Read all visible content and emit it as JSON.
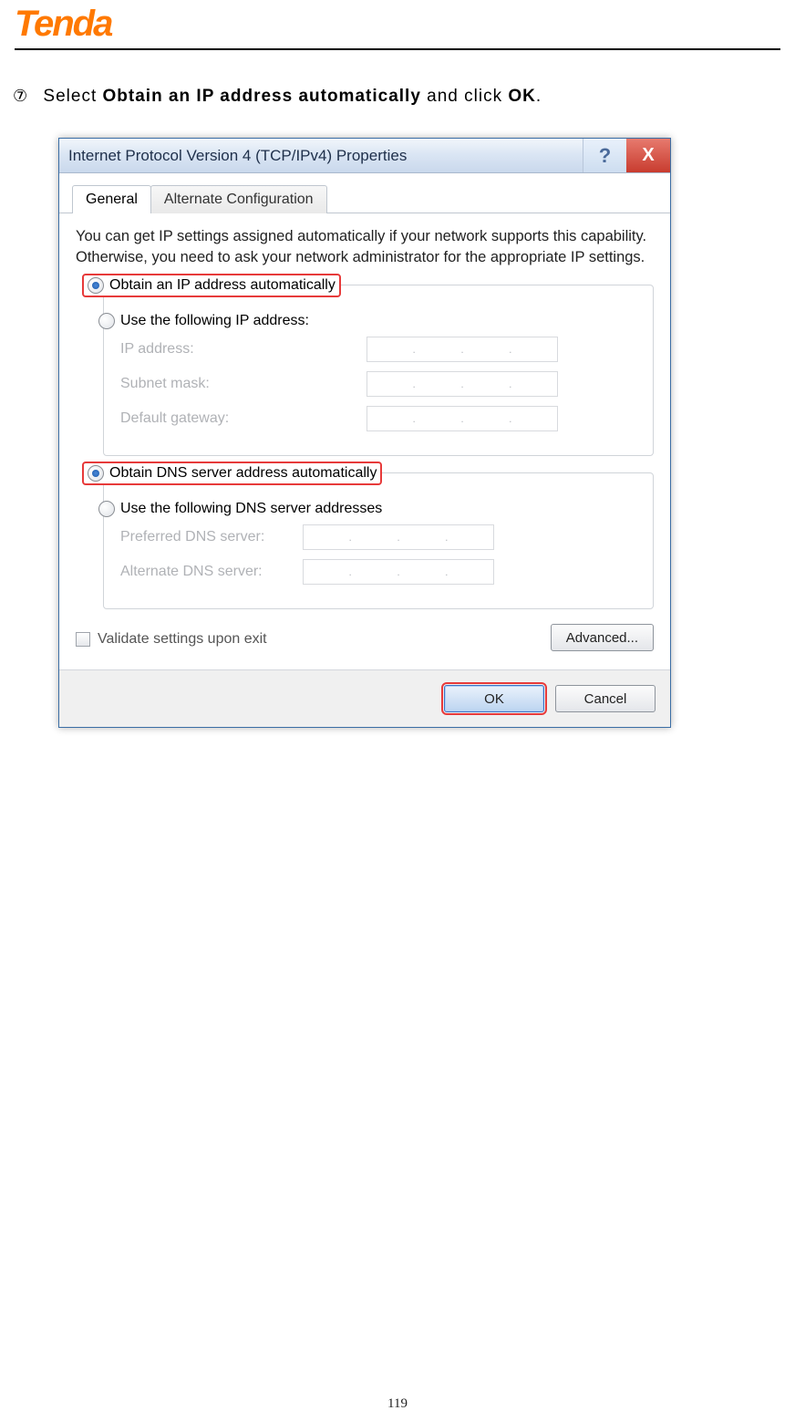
{
  "logo_text": "Tenda",
  "step_marker": "⑦",
  "instruction_prefix": "Select ",
  "instruction_bold1": "Obtain an IP address automatically",
  "instruction_mid": " and click ",
  "instruction_bold2": "OK",
  "instruction_end": ".",
  "dialog": {
    "title": "Internet Protocol Version 4 (TCP/IPv4) Properties",
    "help_icon": "?",
    "close_icon": "X",
    "tabs": {
      "general": "General",
      "alternate": "Alternate Configuration"
    },
    "description": "You can get IP settings assigned automatically if your network supports this capability. Otherwise, you need to ask your network administrator for the appropriate IP settings.",
    "ip_group": {
      "obtain_label": "Obtain an IP address automatically",
      "use_label": "Use the following IP address:",
      "ip_address": "IP address:",
      "subnet": "Subnet mask:",
      "gateway": "Default gateway:"
    },
    "dns_group": {
      "obtain_label": "Obtain DNS server address automatically",
      "use_label": "Use the following DNS server addresses",
      "preferred": "Preferred DNS server:",
      "alternate": "Alternate DNS server:"
    },
    "validate_label": "Validate settings upon exit",
    "advanced_label": "Advanced...",
    "ok_label": "OK",
    "cancel_label": "Cancel",
    "dots": ". . ."
  },
  "page_number": "119"
}
